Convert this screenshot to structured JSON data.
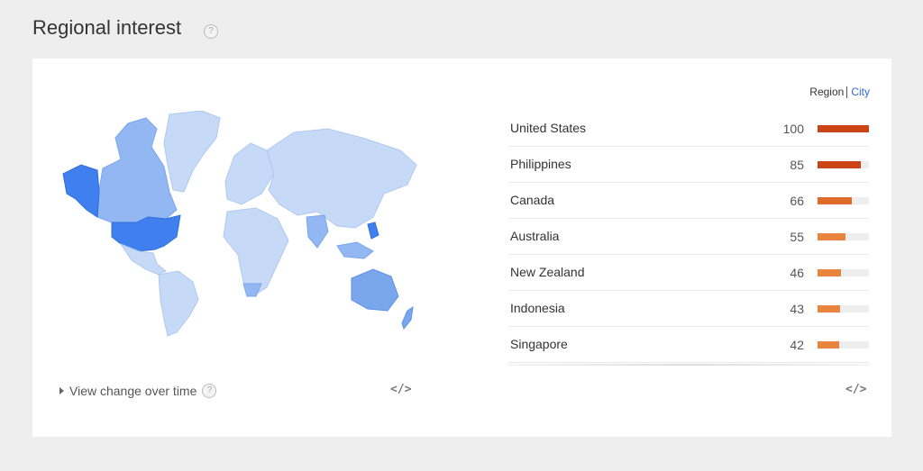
{
  "header": {
    "title": "Regional interest",
    "help": "?"
  },
  "toggle": {
    "region": "Region",
    "city": "City"
  },
  "rows": [
    {
      "name": "United States",
      "value": "100",
      "pct": 100,
      "color": "#cc4414"
    },
    {
      "name": "Philippines",
      "value": "85",
      "pct": 85,
      "color": "#cc4414"
    },
    {
      "name": "Canada",
      "value": "66",
      "pct": 66,
      "color": "#e06a2a"
    },
    {
      "name": "Australia",
      "value": "55",
      "pct": 55,
      "color": "#e8843d"
    },
    {
      "name": "New Zealand",
      "value": "46",
      "pct": 46,
      "color": "#e8843d"
    },
    {
      "name": "Indonesia",
      "value": "43",
      "pct": 43,
      "color": "#e8843d"
    },
    {
      "name": "Singapore",
      "value": "42",
      "pct": 42,
      "color": "#e8843d"
    }
  ],
  "footer": {
    "view_change": "View change over time",
    "help": "?",
    "embed": "</>"
  },
  "colors": {
    "map_light": "#c6daf8",
    "map_mid": "#93b7f2",
    "map_dark": "#3f80ee",
    "accent": "#3367d6"
  }
}
